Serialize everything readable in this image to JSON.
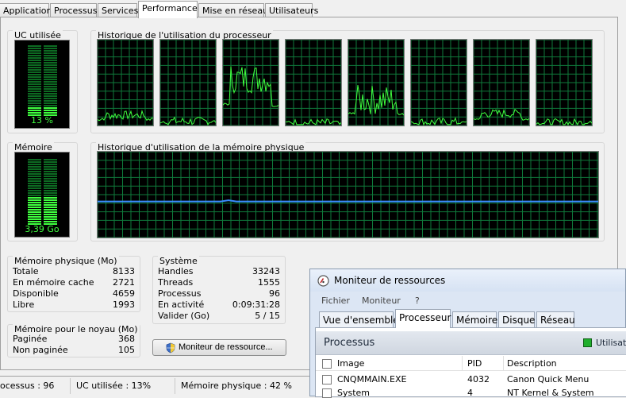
{
  "tabs": [
    "Applications",
    "Processus",
    "Services",
    "Performance",
    "Mise en réseau",
    "Utilisateurs"
  ],
  "cpu": {
    "title": "UC utilisée",
    "value": "13 %",
    "level": 0.13
  },
  "cpu_history": {
    "title": "Historique de l'utilisation du processeur"
  },
  "memory": {
    "title": "Mémoire",
    "value": "3,39 Go",
    "level": 0.42
  },
  "memory_history": {
    "title": "Historique d'utilisation de la mémoire physique"
  },
  "physical_memory": {
    "title": "Mémoire physique (Mo)",
    "rows": [
      {
        "label": "Totale",
        "value": "8133"
      },
      {
        "label": "En mémoire cache",
        "value": "2721"
      },
      {
        "label": "Disponible",
        "value": "4659"
      },
      {
        "label": "Libre",
        "value": "1993"
      }
    ]
  },
  "kernel_memory": {
    "title": "Mémoire pour le noyau (Mo)",
    "rows": [
      {
        "label": "Paginée",
        "value": "368"
      },
      {
        "label": "Non paginée",
        "value": "105"
      }
    ]
  },
  "system": {
    "title": "Système",
    "rows": [
      {
        "label": "Handles",
        "value": "33243"
      },
      {
        "label": "Threads",
        "value": "1555"
      },
      {
        "label": "Processus",
        "value": "96"
      },
      {
        "label": "En activité",
        "value": "0:09:31:28"
      },
      {
        "label": "Valider (Go)",
        "value": "5 / 15"
      }
    ]
  },
  "resource_monitor_button": "Moniteur de ressource...",
  "status": {
    "processes": "ocessus : 96",
    "cpu": "UC utilisée : 13%",
    "memory": "Mémoire physique : 42 %"
  },
  "rm": {
    "title": "Moniteur de ressources",
    "menu": [
      "Fichier",
      "Moniteur",
      "?"
    ],
    "tabs": [
      "Vue d'ensemble",
      "Processeur",
      "Mémoire",
      "Disque",
      "Réseau"
    ],
    "section": "Processus",
    "section_right": "Utilisati",
    "columns": [
      "Image",
      "PID",
      "Description"
    ],
    "rows": [
      {
        "image": "CNQMMAIN.EXE",
        "pid": "4032",
        "desc": "Canon Quick Menu"
      },
      {
        "image": "System",
        "pid": "4",
        "desc": "NT Kernel & System"
      }
    ]
  },
  "colors": {
    "graph_green": "#3fff3f",
    "memory_line": "#3a8dff",
    "grid": "#0f7a3b"
  }
}
